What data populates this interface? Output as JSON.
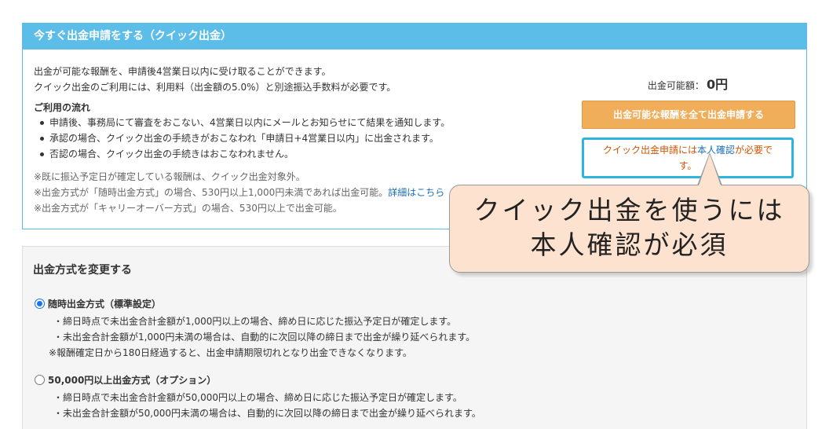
{
  "quick": {
    "header": "今すぐ出金申請をする（クイック出金）",
    "intro": [
      "出金が可能な報酬を、申請後4営業日以内に受け取ることができます。",
      "クイック出金のご利用には、利用料（出金額の5.0%）と別途振込手数料が必要です。"
    ],
    "flow_title": "ご利用の流れ",
    "flow_items": [
      "申請後、事務局にて審査をおこない、4営業日以内にメールとお知らせにて結果を通知します。",
      "承認の場合、クイック出金の手続きがおこなわれ「申請日+4営業日以内」に出金されます。",
      "否認の場合、クイック出金の手続きはおこなわれません。"
    ],
    "notes": [
      "※既に振込予定日が確定している報酬は、クイック出金対象外。",
      "※出金方式が「随時出金方式」の場合、530円以上1,000円未満であれば出金可能。",
      "※出金方式が「キャリーオーバー方式」の場合、530円以上で出金可能。"
    ],
    "detail_link": "詳細はこちら",
    "available_label": "出金可能額：",
    "available_amount": "0円",
    "apply_button": "出金可能な報酬を全て出金申請する",
    "verify_prefix": "クイック出金申請には",
    "verify_link": "本人確認",
    "verify_suffix": "が必要です。"
  },
  "method": {
    "title": "出金方式を変更する",
    "options": [
      {
        "label": "随時出金方式（標準設定）",
        "checked": true,
        "lines": [
          "・締日時点で未出金合計金額が1,000円以上の場合、締め日に応じた振込予定日が確定します。",
          "・未出金合計金額が1,000円未満の場合は、自動的に次回以降の締日まで出金が繰り延べられます。"
        ],
        "note": "※報酬確定日から180日経過すると、出金申請期限切れとなり出金できなくなります。"
      },
      {
        "label": "50,000円以上出金方式（オプション）",
        "checked": false,
        "lines": [
          "・締日時点で未出金合計金額が50,000円以上の場合、締め日に応じた振込予定日が確定します。",
          "・未出金合計金額が50,000円未満の場合は、自動的に次回以降の締日まで出金が繰り延べられます。"
        ]
      }
    ]
  },
  "callout": {
    "line1": "クイック出金を使うには",
    "line2": "本人確認が必須"
  },
  "colors": {
    "header_bg": "#5bbde8",
    "button_bg": "#f0ad5a",
    "highlight_border": "#2fb4e0",
    "callout_bg": "#fde3cf",
    "link": "#1a6fb5"
  }
}
